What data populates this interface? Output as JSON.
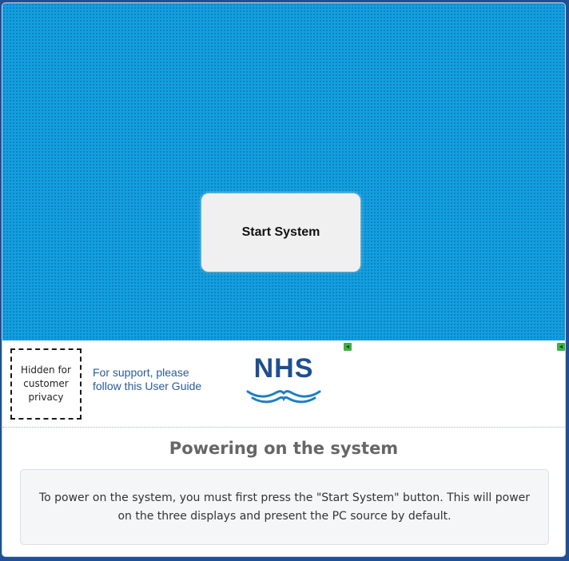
{
  "touch_panel": {
    "start_button_label": "Start System"
  },
  "footer": {
    "privacy_text": "Hidden for customer privacy",
    "support_text": "For support, please follow this User Guide",
    "logo_text": "NHS"
  },
  "instructions": {
    "title": "Powering on the system",
    "body": "To power on the system, you must first press the \"Start System\" button. This will power on the three displays and present the PC source by default."
  },
  "colors": {
    "panel_background": "#139fdf",
    "brand_blue": "#1d4f91",
    "page_background": "#1f4f95"
  }
}
